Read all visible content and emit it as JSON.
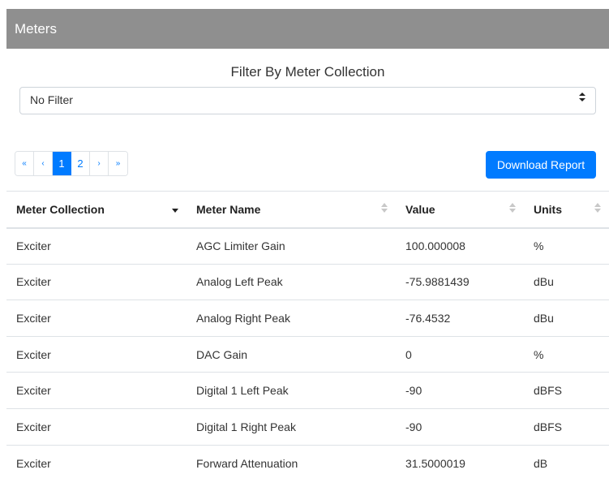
{
  "panel": {
    "title": "Meters"
  },
  "filter": {
    "title": "Filter By Meter Collection",
    "selected": "No Filter",
    "caret": "⬍"
  },
  "pagination": {
    "first": "«",
    "prev": "‹",
    "pages": [
      "1",
      "2"
    ],
    "current_page": "1",
    "next": "›",
    "last": "»"
  },
  "actions": {
    "download_label": "Download Report"
  },
  "colors": {
    "accent": "#007bff",
    "header_bg": "#8f8f8f"
  },
  "table": {
    "headers": [
      "Meter Collection",
      "Meter Name",
      "Value",
      "Units"
    ],
    "sorted_column": "Meter Collection",
    "rows": [
      [
        "Exciter",
        "AGC Limiter Gain",
        "100.000008",
        "%"
      ],
      [
        "Exciter",
        "Analog Left Peak",
        "-75.9881439",
        "dBu"
      ],
      [
        "Exciter",
        "Analog Right Peak",
        "-76.4532",
        "dBu"
      ],
      [
        "Exciter",
        "DAC Gain",
        "0",
        "%"
      ],
      [
        "Exciter",
        "Digital 1 Left Peak",
        "-90",
        "dBFS"
      ],
      [
        "Exciter",
        "Digital 1 Right Peak",
        "-90",
        "dBFS"
      ],
      [
        "Exciter",
        "Forward Attenuation",
        "31.5000019",
        "dB"
      ]
    ]
  }
}
